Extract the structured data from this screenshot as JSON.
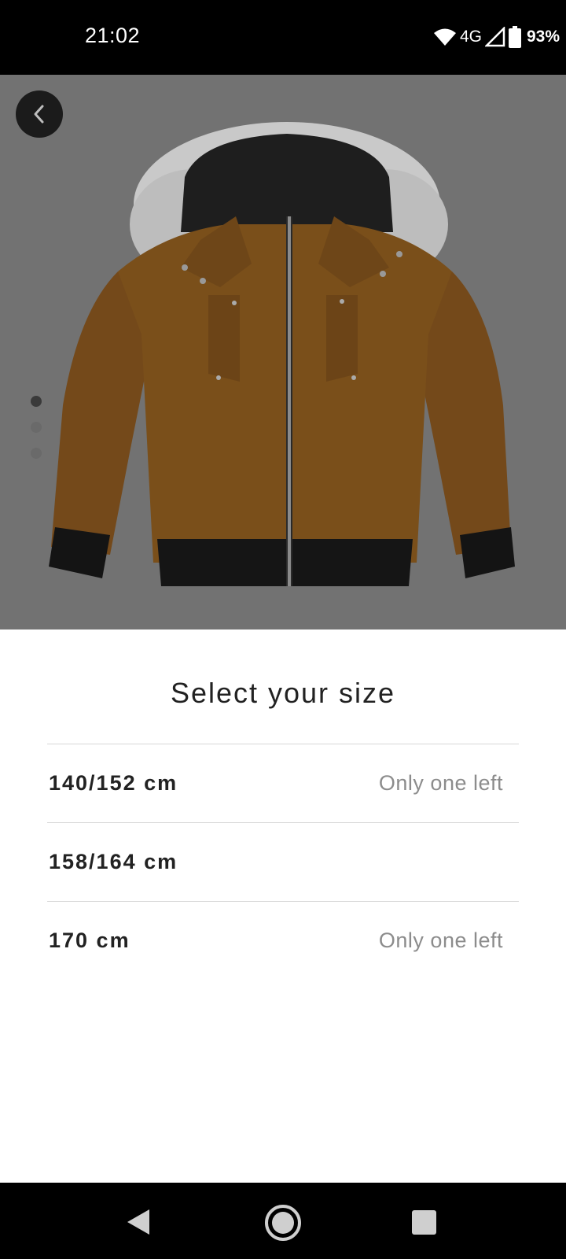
{
  "status_bar": {
    "time": "21:02",
    "network": "4G",
    "battery": "93%",
    "icons": [
      "wifi-icon",
      "signal-icon",
      "battery-icon"
    ]
  },
  "product_image": {
    "icon": "jacket-image",
    "carousel": {
      "count": 3,
      "active_index": 0
    }
  },
  "back_icon": "chevron-left-icon",
  "size_sheet": {
    "title": "Select your size",
    "sizes": [
      {
        "label": "140/152 cm",
        "stock": "Only one left"
      },
      {
        "label": "158/164 cm",
        "stock": ""
      },
      {
        "label": "170 cm",
        "stock": "Only one left"
      }
    ]
  },
  "nav_bar": {
    "icons": [
      "nav-back-icon",
      "nav-home-icon",
      "nav-recents-icon"
    ]
  },
  "colors": {
    "jacket_body": "#7a4f1a",
    "hero_background": "#727272",
    "sheet_background": "#ffffff",
    "stock_text": "#8c8c8c"
  }
}
